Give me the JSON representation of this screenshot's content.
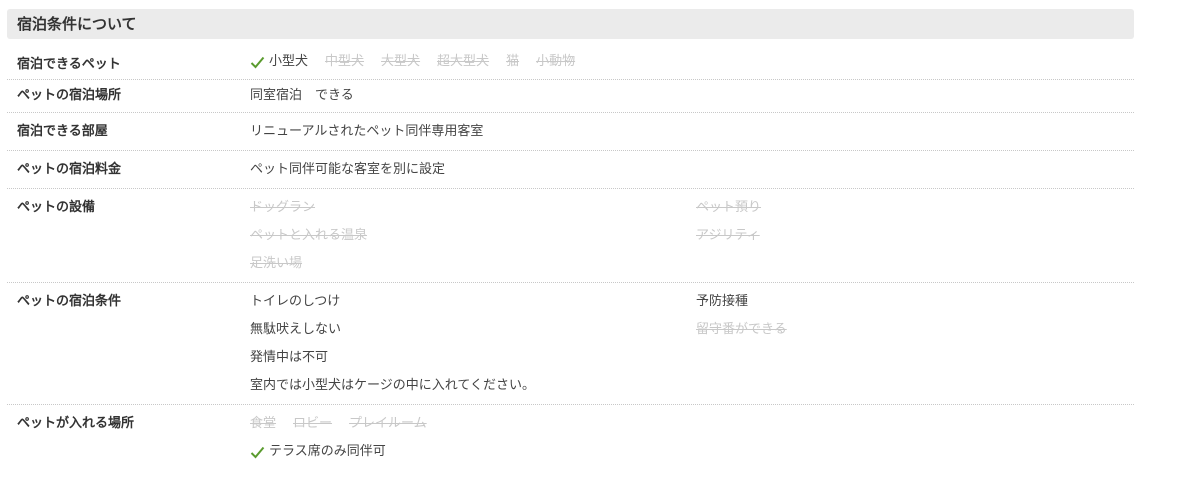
{
  "header": {
    "title": "宿泊条件について"
  },
  "rows": {
    "pets": {
      "label": "宿泊できるペット",
      "items": [
        {
          "text": "小型犬",
          "available": true
        },
        {
          "text": "中型犬",
          "available": false
        },
        {
          "text": "大型犬",
          "available": false
        },
        {
          "text": "超大型犬",
          "available": false
        },
        {
          "text": "猫",
          "available": false
        },
        {
          "text": "小動物",
          "available": false
        }
      ]
    },
    "place": {
      "label": "ペットの宿泊場所",
      "value": "同室宿泊　できる"
    },
    "room": {
      "label": "宿泊できる部屋",
      "value": "リニューアルされたペット同伴専用客室"
    },
    "fee": {
      "label": "ペットの宿泊料金",
      "value": "ペット同伴可能な客室を別に設定"
    },
    "facilities": {
      "label": "ペットの設備",
      "col1": [
        {
          "text": "ドッグラン",
          "available": false
        },
        {
          "text": "ペットと入れる温泉",
          "available": false
        },
        {
          "text": "足洗い場",
          "available": false
        }
      ],
      "col2": [
        {
          "text": "ペット預り",
          "available": false
        },
        {
          "text": "アジリティ",
          "available": false
        }
      ]
    },
    "conditions": {
      "label": "ペットの宿泊条件",
      "col1": [
        {
          "text": "トイレのしつけ",
          "available": true
        },
        {
          "text": "無駄吠えしない",
          "available": true
        },
        {
          "text": "発情中は不可",
          "available": true
        },
        {
          "text": "室内では小型犬はケージの中に入れてください。",
          "available": true
        }
      ],
      "col2": [
        {
          "text": "予防接種",
          "available": true
        },
        {
          "text": "留守番ができる",
          "available": false
        }
      ]
    },
    "areas": {
      "label": "ペットが入れる場所",
      "items": [
        {
          "text": "食堂",
          "available": false
        },
        {
          "text": "ロビー",
          "available": false
        },
        {
          "text": "プレイルーム",
          "available": false
        }
      ],
      "allowed": "テラス席のみ同伴可"
    }
  },
  "colors": {
    "check": "#5a9b2e",
    "disabled": "#c8c8c8",
    "header_bg": "#ebebeb"
  }
}
